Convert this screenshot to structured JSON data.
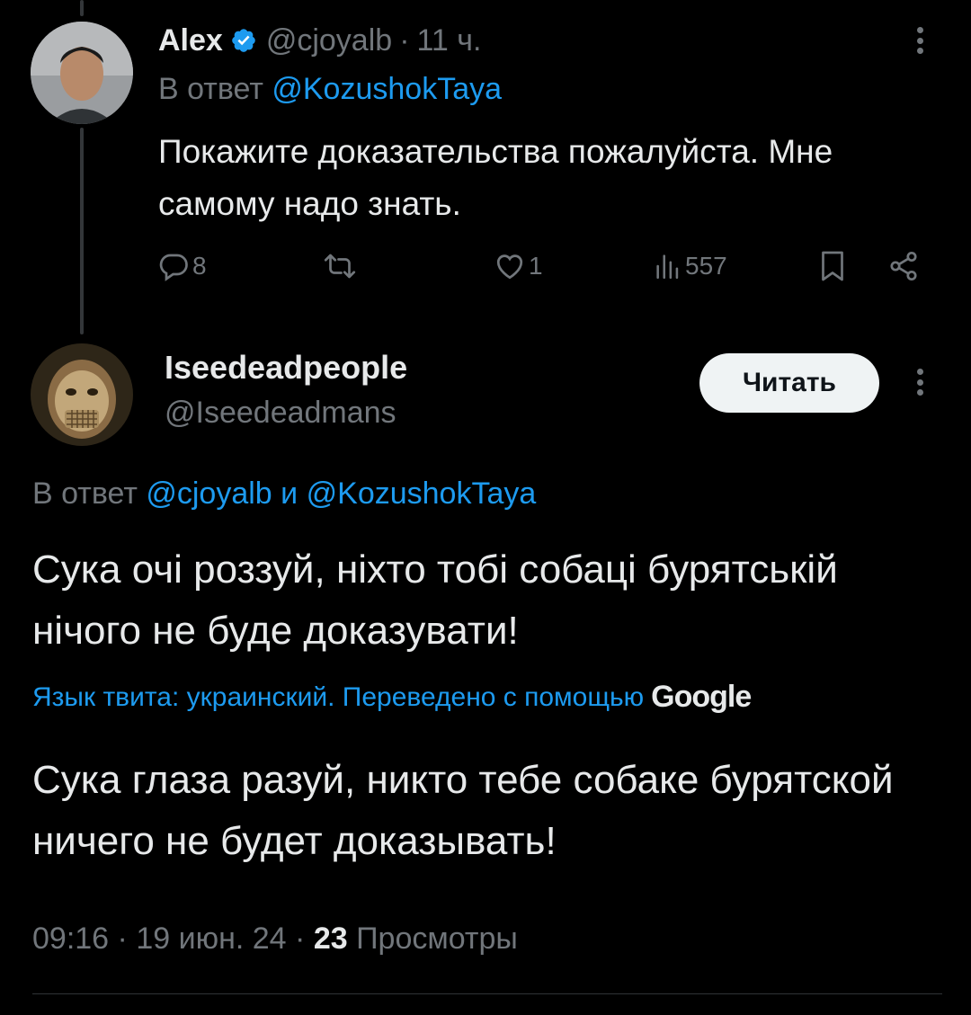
{
  "tweet1": {
    "name": "Alex",
    "handle": "@cjoyalb",
    "separator": "·",
    "time": "11 ч.",
    "reply_prefix": "В ответ",
    "reply_to": "@KozushokTaya",
    "text": "Покажите доказательства пожалуйста. Мне самому надо знать.",
    "actions": {
      "replies": "8",
      "retweets": "",
      "likes": "1",
      "views": "557"
    }
  },
  "tweet2": {
    "name": "Iseedeadpeople",
    "handle": "@Iseedeadmans",
    "follow_label": "Читать",
    "reply_prefix": "В ответ",
    "reply_to_1": "@cjoyalb",
    "reply_conj": "и",
    "reply_to_2": "@KozushokTaya",
    "text": "Сука очі роззуй, ніхто тобі собаці бурятській нічого не буде доказувати!",
    "translation_note": "Язык твита: украинский. Переведено с помощью",
    "translation_brand": "Google",
    "translation": "Сука глаза разуй, никто тебе собаке бурятской ничего не будет доказывать!",
    "time": "09:16",
    "date": "19 июн. 24",
    "views_count": "23",
    "views_label": "Просмотры",
    "separator": "·"
  },
  "colors": {
    "background": "#000000",
    "text": "#e7e9ea",
    "muted": "#71767b",
    "link": "#1d9bf0",
    "verified": "#1d9bf0"
  },
  "icons": [
    "verified-badge-icon",
    "more-icon",
    "reply-icon",
    "retweet-icon",
    "like-icon",
    "views-icon",
    "bookmark-icon",
    "share-icon"
  ]
}
